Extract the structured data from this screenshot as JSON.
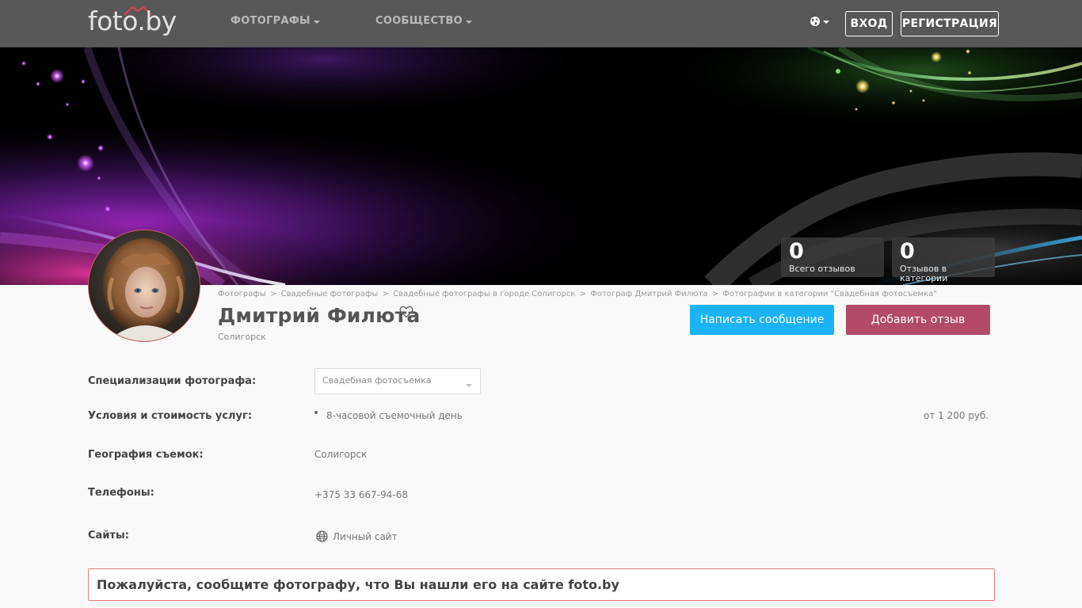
{
  "header": {
    "logo": "foto.by",
    "nav": [
      {
        "label": "ФОТОГРАФЫ"
      },
      {
        "label": "СООБЩЕСТВО"
      }
    ],
    "login_label": "ВХОД",
    "register_label": "РЕГИСТРАЦИЯ"
  },
  "stats": [
    {
      "value": "0",
      "label": "Всего отзывов"
    },
    {
      "value": "0",
      "label": "Отзывов в категории"
    }
  ],
  "breadcrumb": [
    "Фотографы",
    "Свадебные фотографы",
    "Свадебные фотографы в городе Солигорск",
    "Фотограф Дмитрий Филюта",
    "Фотографии в категории \"Свадебная фотосъемка\""
  ],
  "breadcrumb_separator": ">",
  "profile": {
    "name": "Дмитрий Филюта",
    "city": "Солигорск"
  },
  "actions": {
    "message_label": "Написать сообщение",
    "review_label": "Добавить отзыв"
  },
  "info": {
    "specializations_label": "Специализации фотографа:",
    "specialization_selected": "Свадебная фотосъемка",
    "services_label": "Условия и стоимость услуг:",
    "service_name": "8-часовой съемочный день",
    "service_price": "от 1 200 руб.",
    "geography_label": "География съемок:",
    "geography_value": "Солигорск",
    "phones_label": "Телефоны:",
    "phone_value": "+375 33 667-94-68",
    "sites_label": "Сайты:",
    "site_link": "Личный сайт"
  },
  "notice": "Пожалуйста, сообщите фотографу, что Вы нашли его на сайте foto.by",
  "colors": {
    "topbar": "#585858",
    "message_button": "#1ab3f5",
    "review_button": "#b24a68",
    "notice_border": "#e07a7a"
  }
}
